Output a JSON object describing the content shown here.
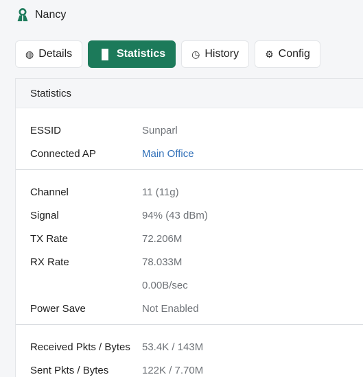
{
  "header": {
    "user_name": "Nancy",
    "user_icon": "user-icon",
    "accent_color": "#1c7a5a"
  },
  "tabs": [
    {
      "label": "Details",
      "icon": "globe-icon",
      "glyph": "◍",
      "active": false
    },
    {
      "label": "Statistics",
      "icon": "bar-chart-icon",
      "glyph": "▐▌",
      "active": true
    },
    {
      "label": "History",
      "icon": "clock-icon",
      "glyph": "◷",
      "active": false
    },
    {
      "label": "Config",
      "icon": "gears-icon",
      "glyph": "⚙",
      "active": false
    }
  ],
  "panel": {
    "title": "Statistics",
    "groups": [
      [
        {
          "label": "ESSID",
          "value": "Sunparl"
        },
        {
          "label": "Connected AP",
          "value": "Main Office",
          "link": true
        }
      ],
      [
        {
          "label": "Channel",
          "value": "11 (11g)"
        },
        {
          "label": "Signal",
          "value": "94% (43 dBm)"
        },
        {
          "label": "TX Rate",
          "value": "72.206M"
        },
        {
          "label": "RX Rate",
          "value": "78.033M"
        },
        {
          "label": "",
          "value": "0.00B/sec"
        },
        {
          "label": "Power Save",
          "value": "Not Enabled"
        }
      ],
      [
        {
          "label": "Received Pkts / Bytes",
          "value": "53.4K / 143M"
        },
        {
          "label": "Sent Pkts / Bytes",
          "value": "122K / 7.70M"
        }
      ]
    ]
  }
}
